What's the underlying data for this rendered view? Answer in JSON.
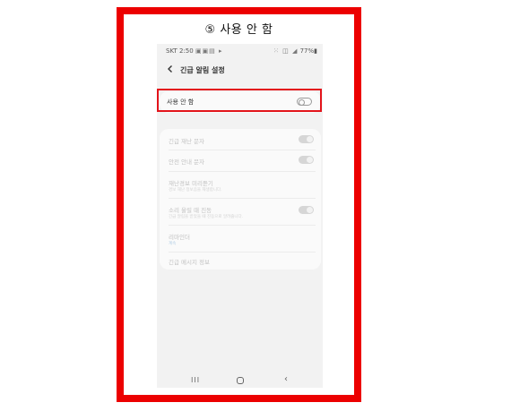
{
  "caption": "⑤ 사용 안 함",
  "statusbar": {
    "left": "SKT 2:50",
    "left_icons": "▣▣▤ ▸",
    "right_icons": "⁙ ◫ ◢",
    "battery": "77%▮"
  },
  "appbar": {
    "back_icon": "chevron-left-icon",
    "title": "긴급 알림 설정"
  },
  "master": {
    "label": "사용 안 함",
    "state": "off"
  },
  "list": [
    {
      "label": "긴급 재난 문자",
      "toggle": "on-disabled"
    },
    {
      "label": "안전 안내 문자",
      "toggle": "on-disabled"
    },
    {
      "label": "재난경보 미리듣기",
      "sub": "경보 재난 정보음을 재생합니다."
    },
    {
      "label": "소리 울릴 때 진동",
      "sub": "긴급 알림을 받았을 때 진동으로 알려줍니다.",
      "toggle": "on-disabled"
    },
    {
      "label": "리마인더",
      "sub": "계속"
    },
    {
      "label": "긴급 메시지 정보"
    }
  ],
  "nav": {
    "recent": "III",
    "back": "‹"
  },
  "colors": {
    "frame": "#ec0000",
    "highlight": "#e3141b",
    "screen_bg": "#f2f2f2"
  }
}
